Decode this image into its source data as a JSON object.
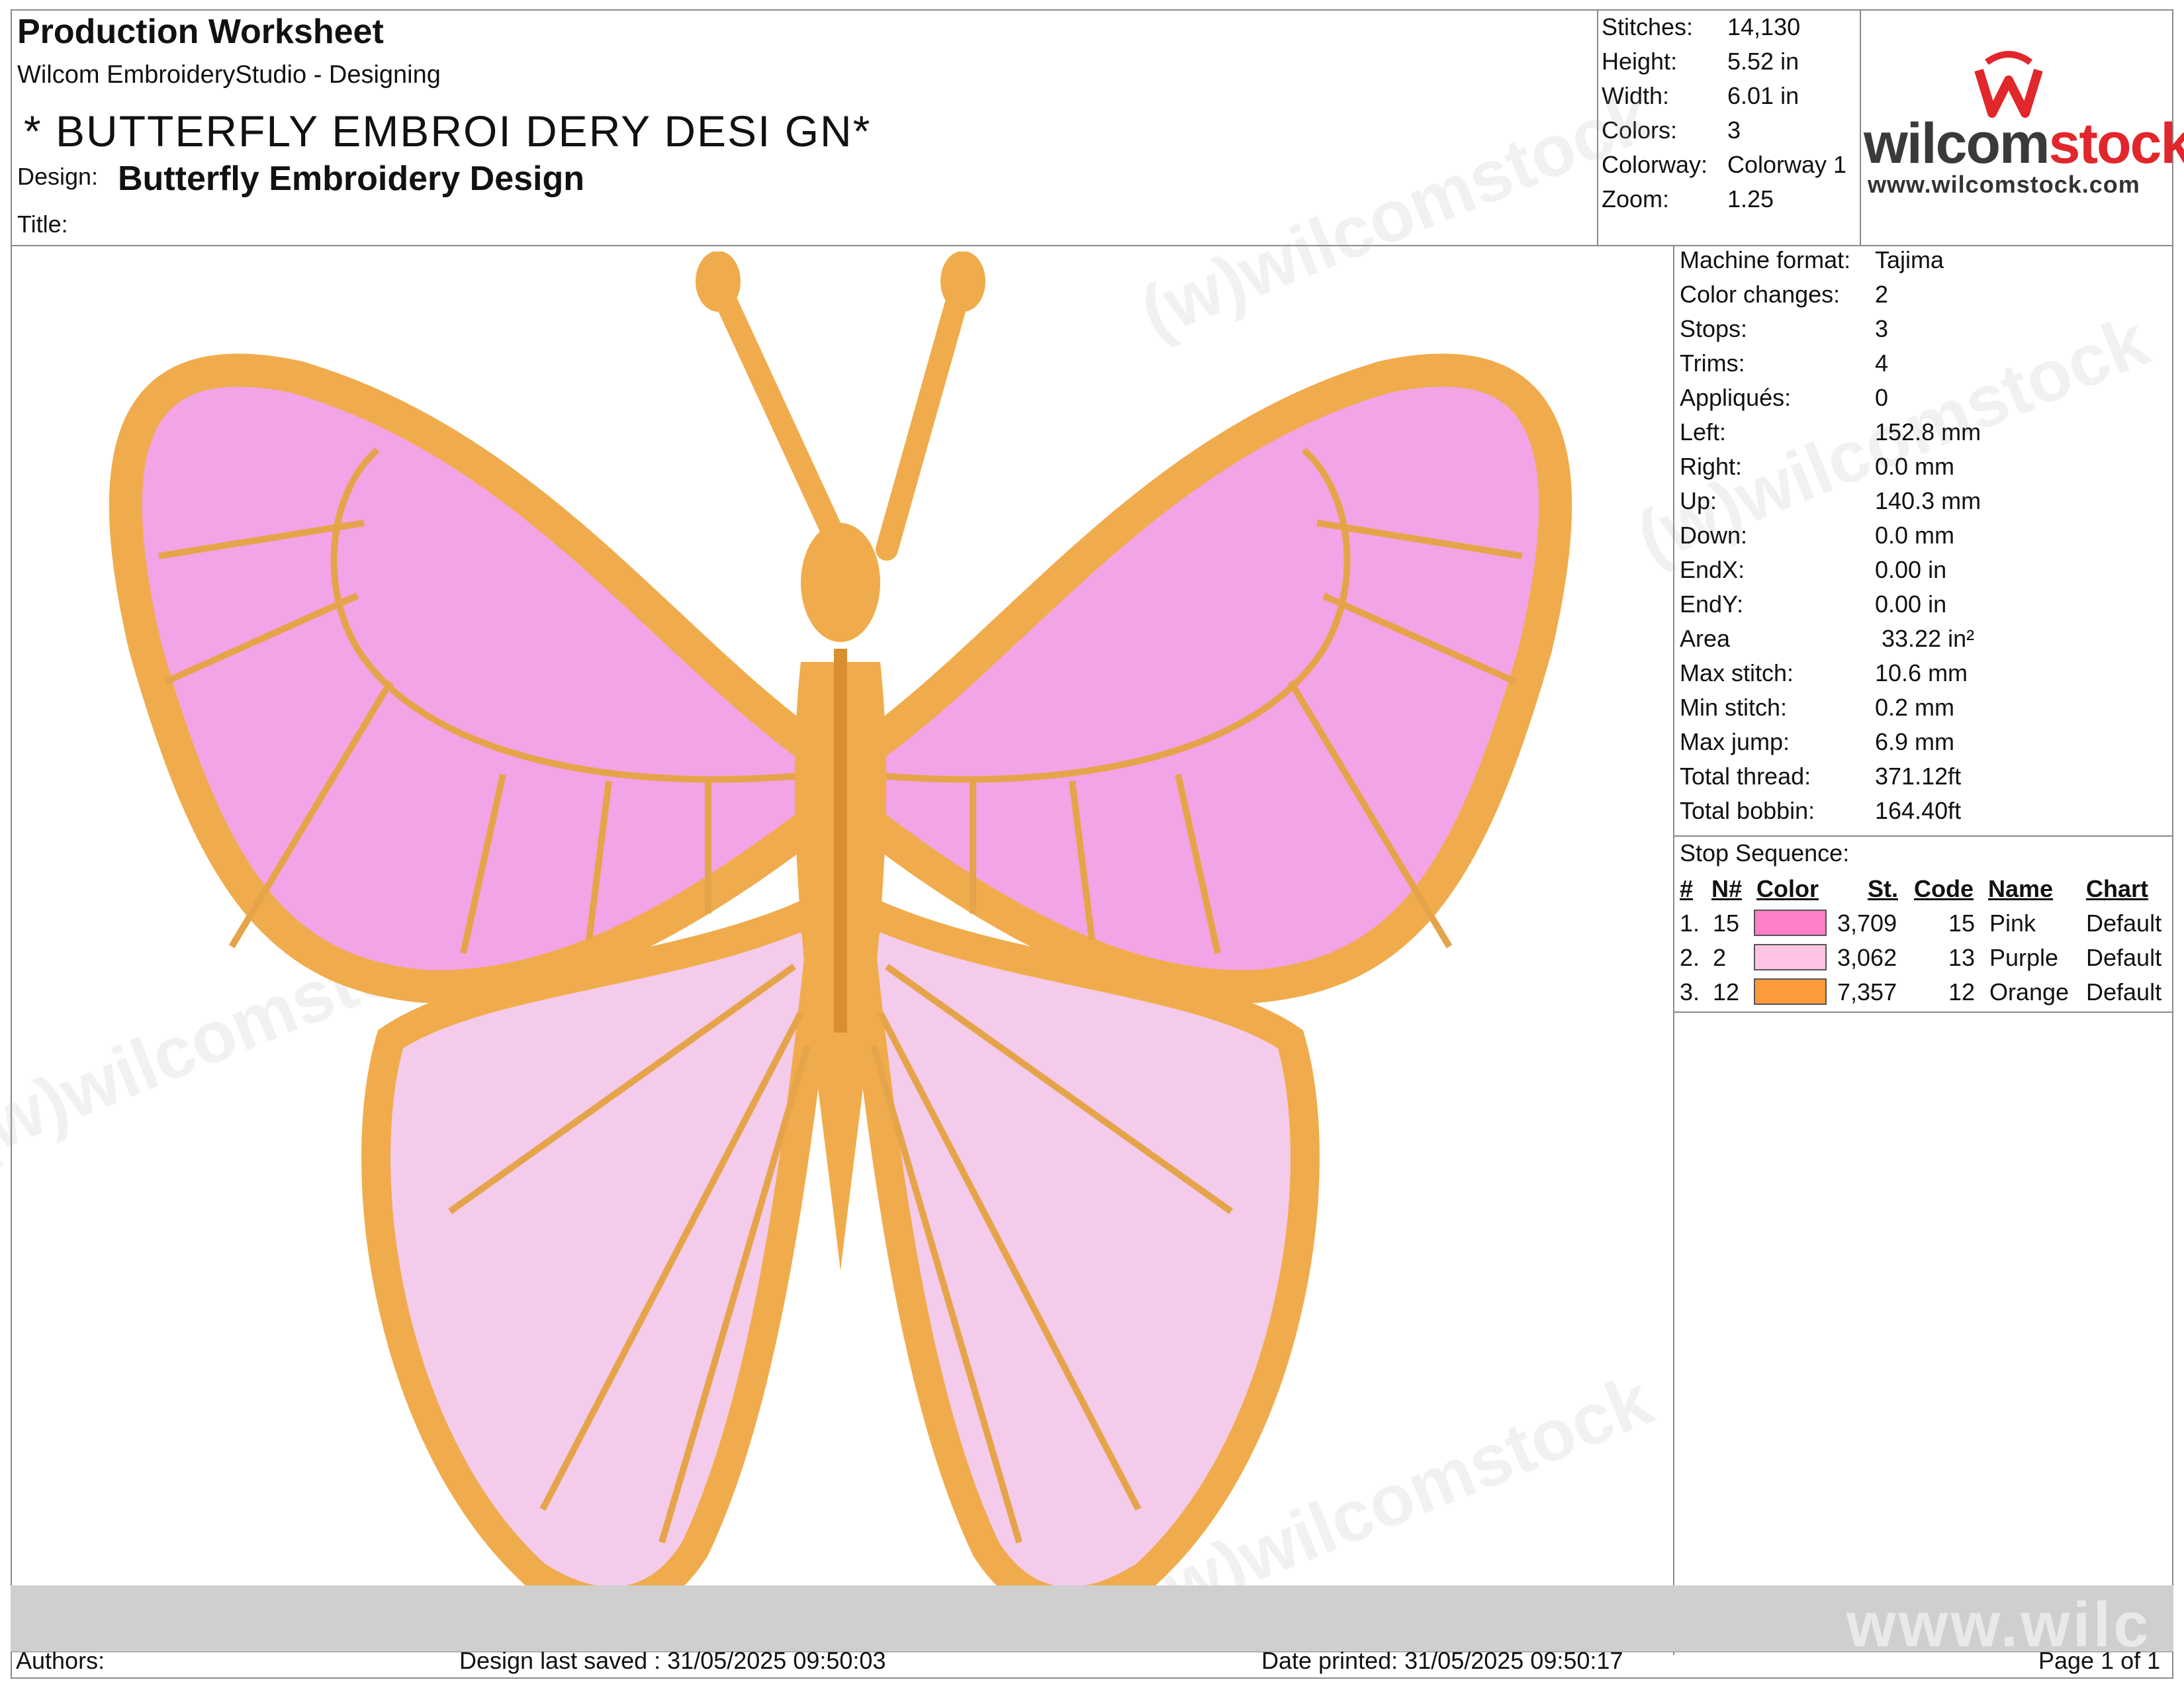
{
  "header": {
    "title": "Production Worksheet",
    "subtitle": "Wilcom EmbroideryStudio - Designing",
    "design_name": "* BUTTERFLY  EMBROI DERY  DESI GN*",
    "design_label": "Design:",
    "design_value": "Butterfly Embroidery Design",
    "title_label": "Title:"
  },
  "summary": [
    {
      "label": "Stitches:",
      "value": "14,130"
    },
    {
      "label": "Height:",
      "value": "5.52 in"
    },
    {
      "label": "Width:",
      "value": "6.01 in"
    },
    {
      "label": "Colors:",
      "value": "3"
    },
    {
      "label": "Colorway:",
      "value": "Colorway 1"
    },
    {
      "label": "Zoom:",
      "value": "1.25"
    }
  ],
  "logo": {
    "brand_part1": "wilcom",
    "brand_part2": "stock",
    "url": "www.wilcomstock.com",
    "dark_color": "#3a3a3a",
    "accent_color": "#e1262c"
  },
  "machine_info": [
    {
      "label": "Machine format:",
      "value": "Tajima"
    },
    {
      "label": "Color changes:",
      "value": "2"
    },
    {
      "label": "Stops:",
      "value": "3"
    },
    {
      "label": "Trims:",
      "value": "4"
    },
    {
      "label": "Appliqués:",
      "value": "0"
    },
    {
      "label": "Left:",
      "value": "152.8 mm"
    },
    {
      "label": "Right:",
      "value": "0.0 mm"
    },
    {
      "label": "Up:",
      "value": "140.3 mm"
    },
    {
      "label": "Down:",
      "value": "0.0 mm"
    },
    {
      "label": "EndX:",
      "value": "0.00 in"
    },
    {
      "label": "EndY:",
      "value": "0.00 in"
    },
    {
      "label": "Area",
      "value": " 33.22 in²"
    },
    {
      "label": "Max stitch:",
      "value": "10.6 mm"
    },
    {
      "label": "Min stitch:",
      "value": "0.2 mm"
    },
    {
      "label": "Max jump:",
      "value": "6.9 mm"
    },
    {
      "label": "Total thread:",
      "value": "371.12ft"
    },
    {
      "label": "Total bobbin:",
      "value": "164.40ft"
    }
  ],
  "stop_sequence": {
    "title": "Stop Sequence:",
    "headers": {
      "num": "#",
      "n": "N#",
      "color": "Color",
      "st": "St.",
      "code": "Code",
      "name": "Name",
      "chart": "Chart"
    },
    "rows": [
      {
        "num": "1.",
        "n": "15",
        "swatch": "#ff7fc8",
        "st": "3,709",
        "code": "15",
        "name": "Pink",
        "chart": "Default"
      },
      {
        "num": "2.",
        "n": "2",
        "swatch": "#ffc4e4",
        "st": "3,062",
        "code": "13",
        "name": "Purple",
        "chart": "Default"
      },
      {
        "num": "3.",
        "n": "12",
        "swatch": "#ff9a3c",
        "st": "7,357",
        "code": "12",
        "name": "Orange",
        "chart": "Default"
      }
    ]
  },
  "design_colors": {
    "outline": "#f0ac4c",
    "outline_dark": "#d98f2f",
    "upper_wing": "#f2a4e6",
    "lower_wing": "#f4cbea",
    "vein": "#e6a44a"
  },
  "watermark": {
    "text": "(w)wilcomstock",
    "bottom_text": "www.wilc"
  },
  "footer": {
    "authors": "Authors:",
    "saved": "Design last saved : 31/05/2025 09:50:03",
    "printed": "Date printed: 31/05/2025 09:50:17",
    "page": "Page 1 of 1"
  }
}
